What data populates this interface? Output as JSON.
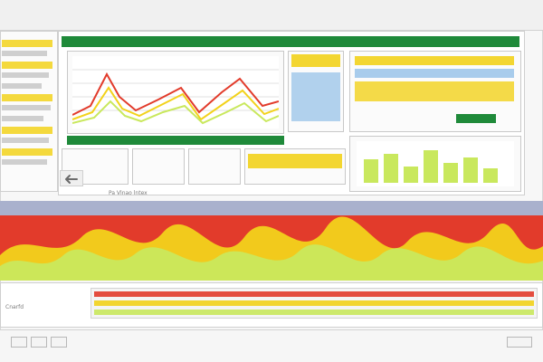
{
  "app": {
    "window_title": "",
    "status_left": "Cnarfd"
  },
  "colors": {
    "brand_green": "#1f8a3a",
    "accent_yellow": "#f2d21b",
    "accent_red": "#e23b2b",
    "accent_lightgreen": "#c9e85d",
    "accent_blue": "#9fc7ea"
  },
  "icons": {
    "left_arrow": "arrow-left-icon"
  },
  "labels": {
    "bottom_caption": "Pa Vlnao lntex"
  }
}
